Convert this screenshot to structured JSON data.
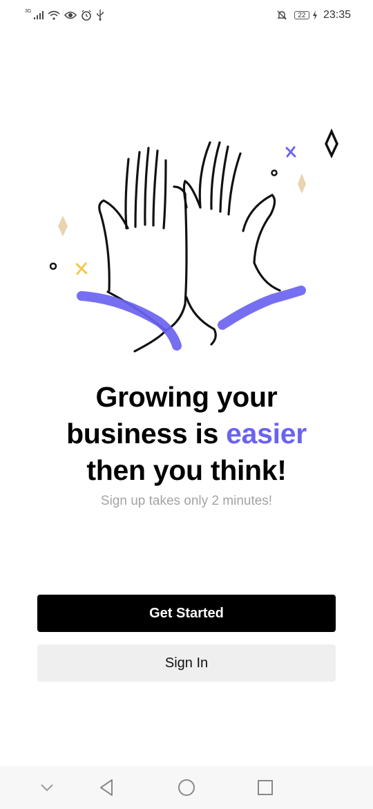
{
  "status_bar": {
    "network_label": "3G",
    "battery_level": "22",
    "time": "23:35",
    "icons": [
      "signal-icon",
      "wifi-icon",
      "eye-icon",
      "alarm-icon",
      "usb-icon",
      "bell-off-icon",
      "battery-icon",
      "charging-icon"
    ]
  },
  "illustration": {
    "name": "high-five-hands",
    "colors": {
      "stroke": "#111111",
      "accent_brush": "#6b63f0",
      "sparkle_gold": "#e8d4b0",
      "cross_yellow": "#f2c94c",
      "cross_purple": "#6b63f0"
    }
  },
  "headline": {
    "line1": "Growing your",
    "line2_prefix": "business is ",
    "line2_accent": "easier",
    "line3": "then you think!",
    "accent_color": "#6b63f0"
  },
  "subtitle": "Sign up takes only 2 minutes!",
  "actions": {
    "primary_label": "Get Started",
    "secondary_label": "Sign In"
  },
  "nav_bar": {
    "icons": [
      "chevron-down-icon",
      "back-icon",
      "home-icon",
      "recents-icon"
    ]
  }
}
